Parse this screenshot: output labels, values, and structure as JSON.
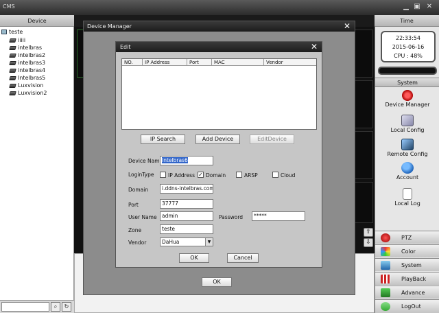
{
  "app": {
    "title": "CMS"
  },
  "headers": {
    "device": "Device",
    "time": "Time"
  },
  "tree": {
    "root": "teste",
    "items": [
      "iiiii",
      "intelbras",
      "intelbras2",
      "intelbras3",
      "intelbras4",
      "Intelbras5",
      "Luxvision",
      "Luxvision2"
    ]
  },
  "clock": {
    "time": "22:33:54",
    "date": "2015-06-16",
    "cpu": "CPU : 48%"
  },
  "system": {
    "header": "System",
    "tools": [
      "Device Manager",
      "Local Config",
      "Remote Config",
      "Account",
      "Local Log"
    ]
  },
  "nav": [
    "PTZ",
    "Color",
    "System",
    "PlayBack",
    "Advance",
    "LogOut"
  ],
  "device_manager": {
    "title": "Device Manager",
    "ok_label": "OK"
  },
  "edit": {
    "title": "Edit",
    "columns": [
      "NO.",
      "IP Address",
      "Port",
      "MAC",
      "Vendor"
    ],
    "buttons": {
      "ip_search": "IP Search",
      "add_device": "Add Device",
      "edit_device": "EditDevice"
    },
    "labels": {
      "device_name": "Device Name",
      "login_type": "LoginType",
      "domain": "Domain",
      "port": "Port",
      "user_name": "User Name",
      "password": "Password",
      "zone": "Zone",
      "vendor": "Vendor"
    },
    "login_options": {
      "ip": "IP Address",
      "domain": "Domain",
      "arsp": "ARSP",
      "cloud": "Cloud"
    },
    "values": {
      "device_name": "Intelbras6",
      "domain": "i.ddns-intelbras.com.br",
      "port": "37777",
      "user_name": "admin",
      "password": "*****",
      "zone": "teste",
      "vendor": "DaHua"
    },
    "ok_label": "OK",
    "cancel_label": "Cancel"
  }
}
